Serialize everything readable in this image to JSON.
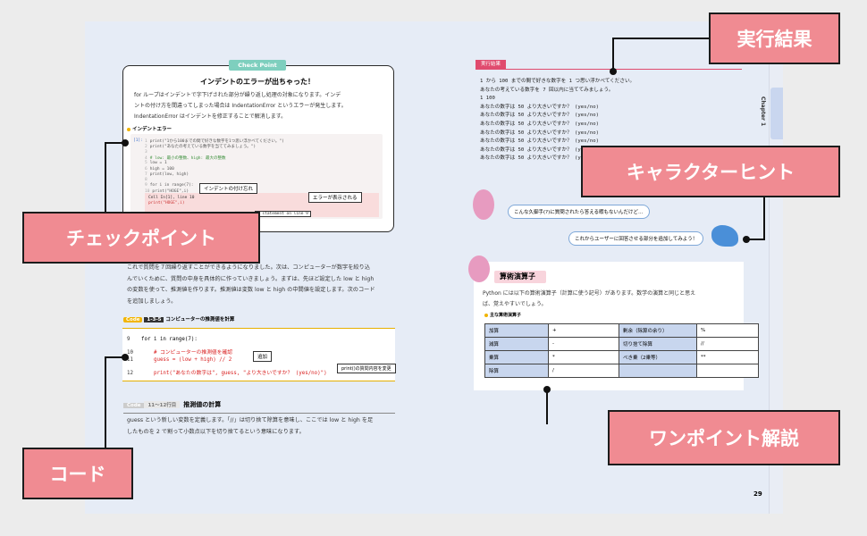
{
  "labels": {
    "run_result": "実行結果",
    "character_hint": "キャラクターヒント",
    "check_point": "チェックポイント",
    "code": "コード",
    "one_point": "ワンポイント解説"
  },
  "check_point": {
    "tag": "Check Point",
    "title": "インデントのエラーが出ちゃった！",
    "body1": "for ループはインデントで字下げされた部分が繰り返し処理の対象になります。インデ",
    "body2": "ントの付け方を間違ってしまった場合は IndentationError というエラーが発生します。",
    "body3": "IndentationError はインデントを修正することで解消します。",
    "subheading": "インデントエラー",
    "code_lines": [
      "print(\"1から100までの間で好きな数字を1つ思い浮かべてください。\")",
      "print(\"あなたの考えている数字を当ててみましょう。\")",
      "",
      "# low: 最小の整数、high: 最大の整数",
      "low = 1",
      "high = 100",
      "print(low, high)",
      "",
      "for i in range(7):",
      "print(\"HOGE\",i)"
    ],
    "error_lines": [
      "Cell In[1], line 10",
      "  print(\"HOGE\",i)"
    ],
    "error_tail": "' statement on line 9",
    "callout_indent": "インデントの付け忘れ",
    "callout_error": "エラーが表示される"
  },
  "left_text": {
    "p1": "これで質問を７回繰り返すことができるようになりました。次は、コンピューターが数字を絞り込",
    "p2": "んでいくために、質問の中身を具体的に作っていきましょう。まずは、先ほど設定した low と high",
    "p3": "の変数を使って、推測値を作ります。推測値は変数 low と high の中間値を設定します。次のコード",
    "p4": "を追加しましょう。"
  },
  "code_block": {
    "tag": "Code",
    "number": "1-3-5",
    "title": "コンピューターの推測値を計算",
    "lines": [
      {
        "n": "9",
        "text": "for i in range(7):"
      },
      {
        "n": "10",
        "text": "    # コンピューターの推測値を確認"
      },
      {
        "n": "11",
        "text": "    guess = (low + high) // 2"
      },
      {
        "n": "12",
        "text": "    print(\"あなたの数字は\", guess, \"より大きいですか？ (yes/no)\")"
      }
    ],
    "callout_add": "追加",
    "callout_print": "print()の質問内容を変更"
  },
  "code_expl": {
    "tag": "Code",
    "lines": "11～12行目",
    "title": "推測値の計算",
    "p1": "guess という新しい変数を定義します。「//」は切り捨て除算を意味し、ここでは low と high を足",
    "p2": "したものを 2 で割って小数点以下を切り捨てるという意味になります。"
  },
  "run": {
    "tag": "実行結果",
    "lines": [
      "1 から 100 までの間で好きな数字を 1 つ思い浮かべてください。",
      "あなたの考えている数字を 7 回以内に当ててみましょう。",
      "1 100",
      "あなたの数字は 50 より大きいですか？ (yes/no)",
      "あなたの数字は 50 より大きいですか？ (yes/no)",
      "あなたの数字は 50 より大きいですか？ (yes/no)",
      "あなたの数字は 50 より大きいですか？ (yes/no)",
      "あなたの数字は 50 より大きいですか？ (yes/no)",
      "あなたの数字は 50 より大きいですか？ (yes/no)",
      "あなたの数字は 50 より大きいですか？ (yes/no)"
    ]
  },
  "hints": {
    "bubble1": "こんな久御手(?)に質問されたら答える暇もないんだけど…",
    "bubble2": "これからユーザーに回答させる部分を追加してみよう！"
  },
  "operators": {
    "title": "算術演算子",
    "text1": "Python には以下の算術演算子（計算に使う記号）があります。数学の演算と同じと思え",
    "text2": "ば、覚えやすいでしょう。",
    "subheading": "主な算術演算子",
    "rows": [
      [
        "加算",
        "+",
        "剰余（除算の余り）",
        "%"
      ],
      [
        "減算",
        "-",
        "切り捨て除算",
        "//"
      ],
      [
        "乗算",
        "*",
        "べき乗（2乗等）",
        "**"
      ],
      [
        "除算",
        "/",
        "",
        ""
      ]
    ]
  },
  "chapter": "Chapter 1",
  "page_number": "29",
  "colors": {
    "label_pink": "#f08b92",
    "accent_red": "#e04b6e",
    "teal": "#7ecfbe",
    "yellow": "#f2b500"
  }
}
